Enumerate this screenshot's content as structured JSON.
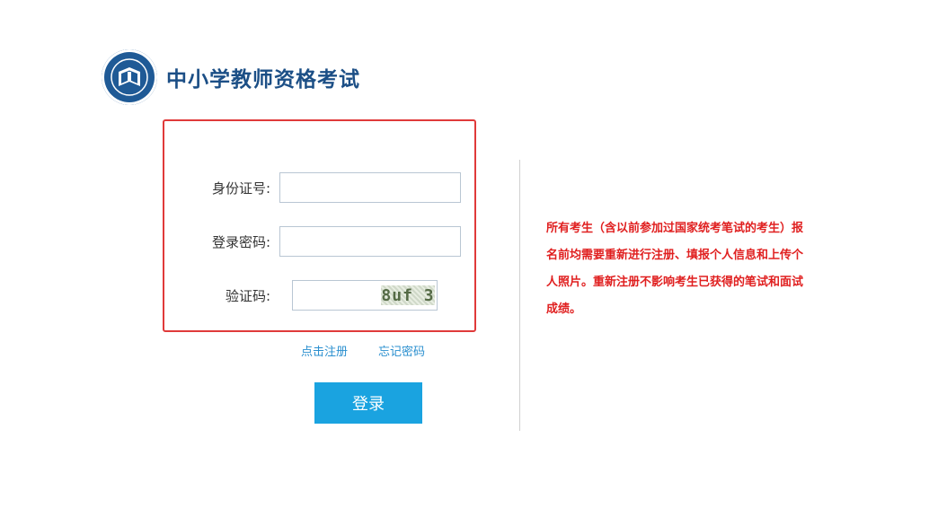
{
  "header": {
    "title": "中小学教师资格考试",
    "logo_icon": "exam-logo-icon"
  },
  "login": {
    "id_label": "身份证号:",
    "id_value": "",
    "password_label": "登录密码:",
    "password_value": "",
    "captcha_label": "验证码:",
    "captcha_value": "",
    "captcha_image_text": "8uf 3",
    "register_link": "点击注册",
    "forgot_link": "忘记密码",
    "submit_label": "登录"
  },
  "notice": {
    "text": "所有考生（含以前参加过国家统考笔试的考生）报名前均需要重新进行注册、填报个人信息和上传个人照片。重新注册不影响考生已获得的笔试和面试成绩。"
  },
  "colors": {
    "brand": "#1c4f86",
    "highlight_border": "#e03a3a",
    "button": "#1aa3e0",
    "link": "#2a8fcf",
    "notice": "#e02020"
  }
}
